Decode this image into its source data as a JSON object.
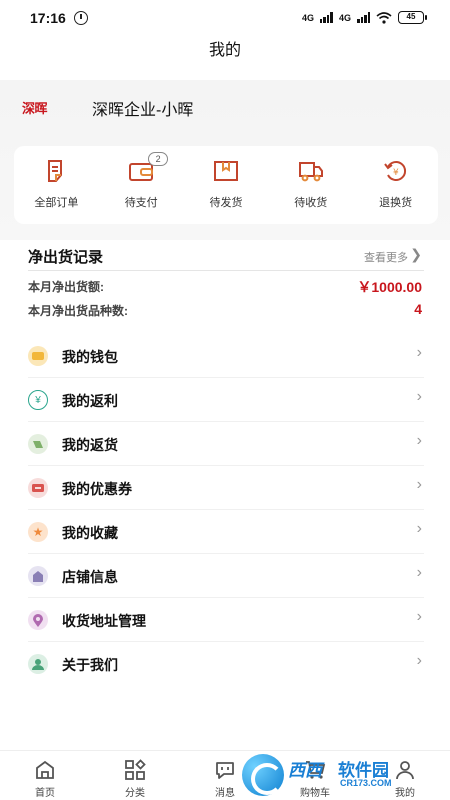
{
  "status": {
    "time": "17:16",
    "battery": "45",
    "network_a": "4G",
    "network_b": "4G"
  },
  "header": {
    "title": "我的"
  },
  "profile": {
    "logo_text": "深晖",
    "name": "深晖企业-小晖"
  },
  "orders": [
    {
      "label": "全部订单",
      "icon": "document-icon"
    },
    {
      "label": "待支付",
      "icon": "wallet-icon",
      "badge": "2"
    },
    {
      "label": "待发货",
      "icon": "box-icon"
    },
    {
      "label": "待收货",
      "icon": "truck-icon"
    },
    {
      "label": "退换货",
      "icon": "refund-icon"
    }
  ],
  "records": {
    "title": "净出货记录",
    "view_more": "查看更多",
    "amount_label": "本月净出货额:",
    "amount_value": "￥1000.00",
    "kinds_label": "本月净出货品种数:",
    "kinds_value": "4"
  },
  "menu": [
    {
      "label": "我的钱包",
      "icon": "wallet-icon",
      "color": "#f2b73a"
    },
    {
      "label": "我的返利",
      "icon": "yen-icon",
      "color": "#2aa58d"
    },
    {
      "label": "我的返货",
      "icon": "return-goods-icon",
      "color": "#7fb06a"
    },
    {
      "label": "我的优惠券",
      "icon": "coupon-icon",
      "color": "#d9534f"
    },
    {
      "label": "我的收藏",
      "icon": "star-icon",
      "color": "#ef8a3c"
    },
    {
      "label": "店铺信息",
      "icon": "shop-icon",
      "color": "#8a7fb5"
    },
    {
      "label": "收货地址管理",
      "icon": "location-icon",
      "color": "#b06ab0"
    },
    {
      "label": "关于我们",
      "icon": "person-icon",
      "color": "#4aa37a"
    }
  ],
  "tabs": [
    {
      "label": "首页",
      "icon": "home-icon"
    },
    {
      "label": "分类",
      "icon": "category-icon"
    },
    {
      "label": "消息",
      "icon": "message-icon"
    },
    {
      "label": "购物车",
      "icon": "cart-icon"
    },
    {
      "label": "我的",
      "icon": "profile-icon"
    }
  ],
  "watermark": {
    "brand": "西西",
    "suffix": "软件园",
    "domain": "CR173.COM"
  }
}
